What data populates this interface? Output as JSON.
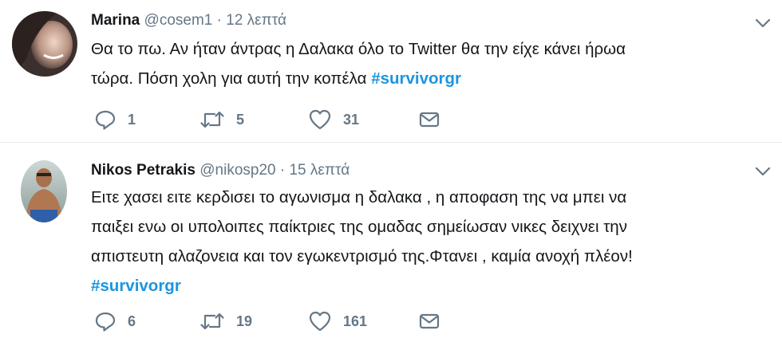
{
  "tweets": [
    {
      "author_name": "Marina",
      "handle": "@cosem1",
      "separator": "·",
      "time": "12 λεπτά",
      "text_line1": "Θα το πω. Αν ήταν άντρας η Δαλακα όλο το Twitter θα την είχε κάνει ήρωα",
      "text_line2": "τώρα. Πόση χολη για αυτή την κοπέλα ",
      "hashtag": "#survivorgr",
      "replies": "1",
      "retweets": "5",
      "likes": "31"
    },
    {
      "author_name": "Nikos Petrakis",
      "handle": "@nikosp20",
      "separator": "·",
      "time": "15 λεπτά",
      "text_line1": "Ειτε χασει ειτε κερδισει το αγωνισμα η δαλακα , η αποφαση της να μπει να",
      "text_line2": "παιξει ενω οι υπολοιπες παίκτριες της ομαδας σημείωσαν νικες δειχνει την",
      "text_line3": "απιστευτη αλαζονεια και τον εγωκεντρισμό της.Φτανει , καμία ανοχή πλέον!",
      "hashtag": "#survivorgr",
      "replies": "6",
      "retweets": "19",
      "likes": "161"
    }
  ],
  "colors": {
    "text": "#14171a",
    "secondary": "#657786",
    "hashtag": "#1b95e0",
    "divider": "#e6ecf0"
  },
  "icons": [
    "reply-icon",
    "retweet-icon",
    "like-icon",
    "direct-message-icon",
    "chevron-down-icon"
  ]
}
